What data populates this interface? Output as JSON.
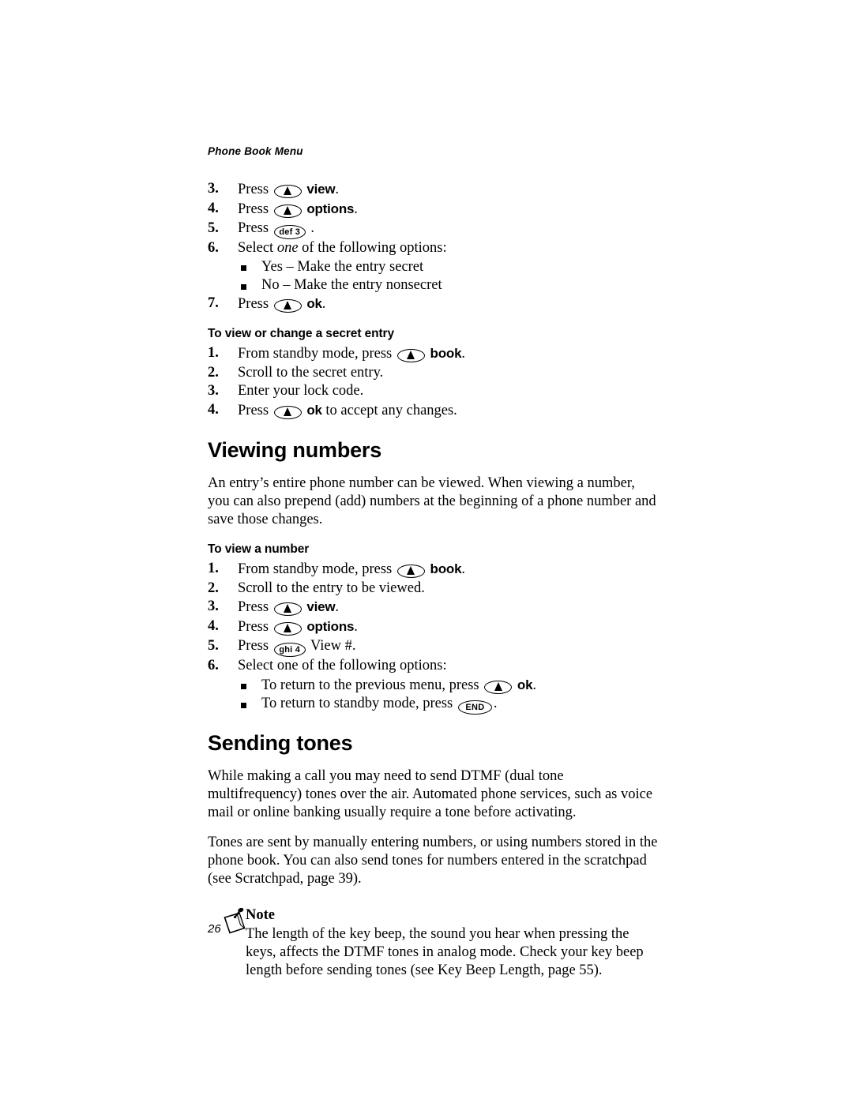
{
  "page": {
    "running_header": "Phone Book Menu",
    "folio": "26"
  },
  "icons": {
    "softkey": "softkey-up-arrow-icon",
    "key_def3": "def 3",
    "key_ghi4": "ghi 4",
    "key_end": "END",
    "note": "note-pushpin-icon",
    "bullet": "square-bullet-icon"
  },
  "continued_steps": {
    "items": [
      {
        "num": "3.",
        "before": "Press",
        "key": "softkey",
        "label": "view",
        "after": "."
      },
      {
        "num": "4.",
        "before": "Press",
        "key": "softkey",
        "label": "options",
        "after": "."
      },
      {
        "num": "5.",
        "before": "Press",
        "key": "def3",
        "label": "",
        "after": "."
      },
      {
        "num": "6.",
        "before": "Select",
        "emphasis": "one",
        "after": "of the following options:"
      },
      {
        "num": "7.",
        "before": "Press",
        "key": "softkey",
        "label": "ok",
        "after": "."
      }
    ],
    "bullets": [
      "Yes – Make the entry secret",
      "No – Make the entry nonsecret"
    ]
  },
  "secret_entry": {
    "heading": "To view or change a secret entry",
    "steps": [
      {
        "num": "1.",
        "before": "From standby mode, press",
        "key": "softkey",
        "label": "book",
        "after": "."
      },
      {
        "num": "2.",
        "text": "Scroll to the secret entry."
      },
      {
        "num": "3.",
        "text": "Enter your lock code."
      },
      {
        "num": "4.",
        "before": "Press",
        "key": "softkey",
        "label": "ok",
        "after": "to accept any changes."
      }
    ]
  },
  "viewing_numbers": {
    "heading": "Viewing numbers",
    "intro": "An entry’s entire phone number can be viewed. When viewing a number, you can also prepend (add) numbers at the beginning of a phone number and save those changes.",
    "sub_heading": "To view a number",
    "steps": [
      {
        "num": "1.",
        "before": "From standby mode, press",
        "key": "softkey",
        "label": "book",
        "after": "."
      },
      {
        "num": "2.",
        "text": "Scroll to the entry to be viewed."
      },
      {
        "num": "3.",
        "before": "Press",
        "key": "softkey",
        "label": "view",
        "after": "."
      },
      {
        "num": "4.",
        "before": "Press",
        "key": "softkey",
        "label": "options",
        "after": "."
      },
      {
        "num": "5.",
        "before": "Press",
        "key": "ghi4",
        "label": "",
        "after": "View #."
      },
      {
        "num": "6.",
        "text": "Select one of the following options:"
      }
    ],
    "bullets": [
      {
        "before": "To return to the previous menu, press",
        "key": "softkey",
        "label": "ok",
        "after": "."
      },
      {
        "before": "To return to standby mode, press",
        "key": "end",
        "label": "",
        "after": "."
      }
    ]
  },
  "sending_tones": {
    "heading": "Sending tones",
    "para1": "While making a call you may need to send DTMF (dual tone multifrequency) tones over the air. Automated phone services, such as voice mail or online banking usually require a tone before activating.",
    "para2": "Tones are sent by manually entering numbers, or using numbers stored in the phone book. You can also send tones for numbers entered in the scratchpad (see Scratchpad, page 39).",
    "note": {
      "title": "Note",
      "body": "The length of the key beep, the sound you hear when pressing the keys, affects the DTMF tones in analog mode. Check your key beep length before sending tones (see Key Beep Length, page 55)."
    }
  }
}
